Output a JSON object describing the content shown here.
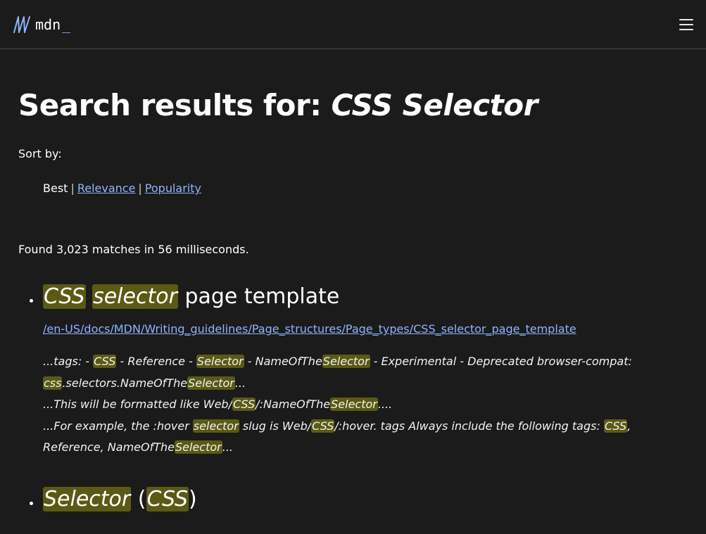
{
  "header": {
    "logo_text": "mdn",
    "logo_cursor": "_",
    "menu_icon": "hamburger-menu-icon"
  },
  "page": {
    "title_prefix": "Search results for: ",
    "query": "CSS Selector"
  },
  "sort": {
    "label": "Sort by:",
    "current": "Best",
    "options": [
      "Relevance",
      "Popularity"
    ],
    "separator": "|"
  },
  "summary": "Found 3,023 matches in 56 milliseconds.",
  "results": [
    {
      "title_parts": [
        {
          "text": "CSS",
          "hl": true
        },
        {
          "text": " ",
          "hl": false
        },
        {
          "text": "selector",
          "hl": true
        },
        {
          "text": " page template",
          "hl": false
        }
      ],
      "url": "/en-US/docs/MDN/Writing_guidelines/Page_structures/Page_types/CSS_selector_page_template",
      "snippet_lines": [
        [
          {
            "text": "...tags: - ",
            "hl": false
          },
          {
            "text": "CSS",
            "hl": true
          },
          {
            "text": " - Reference - ",
            "hl": false
          },
          {
            "text": "Selector",
            "hl": true
          },
          {
            "text": " - NameOfThe",
            "hl": false
          },
          {
            "text": "Selector",
            "hl": true
          },
          {
            "text": " - Experimental - Deprecated browser-compat:",
            "hl": false
          }
        ],
        [
          {
            "text": "css",
            "hl": true
          },
          {
            "text": ".selectors.NameOfThe",
            "hl": false
          },
          {
            "text": "Selector",
            "hl": true
          },
          {
            "text": "...",
            "hl": false
          }
        ],
        [
          {
            "text": "...This will be formatted like Web/",
            "hl": false
          },
          {
            "text": "CSS",
            "hl": true
          },
          {
            "text": "/:NameOfThe",
            "hl": false
          },
          {
            "text": "Selector",
            "hl": true
          },
          {
            "text": "....",
            "hl": false
          }
        ],
        [
          {
            "text": "...For example, the :hover ",
            "hl": false
          },
          {
            "text": "selector",
            "hl": true
          },
          {
            "text": " slug is Web/",
            "hl": false
          },
          {
            "text": "CSS",
            "hl": true
          },
          {
            "text": "/:hover. tags Always include the following tags: ",
            "hl": false
          },
          {
            "text": "CSS",
            "hl": true
          },
          {
            "text": ",",
            "hl": false
          }
        ],
        [
          {
            "text": "Reference, NameOfThe",
            "hl": false
          },
          {
            "text": "Selector",
            "hl": true
          },
          {
            "text": "...",
            "hl": false
          }
        ]
      ]
    },
    {
      "title_parts": [
        {
          "text": "Selector",
          "hl": true
        },
        {
          "text": " (",
          "hl": false
        },
        {
          "text": "CSS",
          "hl": true
        },
        {
          "text": ")",
          "hl": false
        }
      ],
      "url": "",
      "snippet_lines": []
    }
  ]
}
